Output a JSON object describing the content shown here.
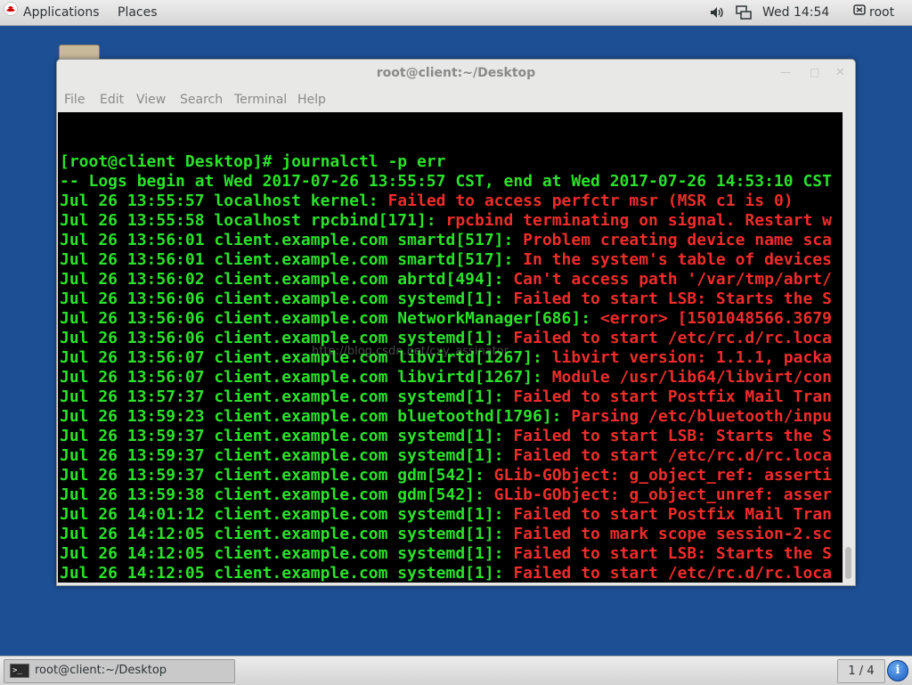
{
  "top_panel": {
    "applications_label": "Applications",
    "places_label": "Places",
    "clock": "Wed 14:54",
    "user_label": "root"
  },
  "window": {
    "title": "root@client:~/Desktop",
    "menu": {
      "file": "File",
      "edit": "Edit",
      "view": "View",
      "search": "Search",
      "terminal": "Terminal",
      "help": "Help"
    }
  },
  "terminal": {
    "lines": [
      {
        "green": "[root@client Desktop]# journalctl -p err",
        "red": ""
      },
      {
        "green": "-- Logs begin at Wed 2017-07-26 13:55:57 CST, end at Wed 2017-07-26 14:53:10 CST",
        "red": ""
      },
      {
        "green": "Jul 26 13:55:57 localhost kernel: ",
        "red": "Failed to access perfctr msr (MSR c1 is 0)"
      },
      {
        "green": "Jul 26 13:55:58 localhost rpcbind[171]: ",
        "red": "rpcbind terminating on signal. Restart w"
      },
      {
        "green": "Jul 26 13:56:01 client.example.com smartd[517]: ",
        "red": "Problem creating device name sca"
      },
      {
        "green": "Jul 26 13:56:01 client.example.com smartd[517]: ",
        "red": "In the system's table of devices"
      },
      {
        "green": "Jul 26 13:56:02 client.example.com abrtd[494]: ",
        "red": "Can't access path '/var/tmp/abrt/"
      },
      {
        "green": "Jul 26 13:56:06 client.example.com systemd[1]: ",
        "red": "Failed to start LSB: Starts the S"
      },
      {
        "green": "Jul 26 13:56:06 client.example.com NetworkManager[686]: ",
        "red": "<error> [1501048566.3679"
      },
      {
        "green": "Jul 26 13:56:06 client.example.com systemd[1]: ",
        "red": "Failed to start /etc/rc.d/rc.loca"
      },
      {
        "green": "Jul 26 13:56:07 client.example.com libvirtd[1267]: ",
        "red": "libvirt version: 1.1.1, packa"
      },
      {
        "green": "Jul 26 13:56:07 client.example.com libvirtd[1267]: ",
        "red": "Module /usr/lib64/libvirt/con"
      },
      {
        "green": "Jul 26 13:57:37 client.example.com systemd[1]: ",
        "red": "Failed to start Postfix Mail Tran"
      },
      {
        "green": "Jul 26 13:59:23 client.example.com bluetoothd[1796]: ",
        "red": "Parsing /etc/bluetooth/inpu"
      },
      {
        "green": "Jul 26 13:59:37 client.example.com systemd[1]: ",
        "red": "Failed to start LSB: Starts the S"
      },
      {
        "green": "Jul 26 13:59:37 client.example.com systemd[1]: ",
        "red": "Failed to start /etc/rc.d/rc.loca"
      },
      {
        "green": "Jul 26 13:59:37 client.example.com gdm[542]: ",
        "red": "GLib-GObject: g_object_ref: asserti"
      },
      {
        "green": "Jul 26 13:59:38 client.example.com gdm[542]: ",
        "red": "GLib-GObject: g_object_unref: asser"
      },
      {
        "green": "Jul 26 14:01:12 client.example.com systemd[1]: ",
        "red": "Failed to start Postfix Mail Tran"
      },
      {
        "green": "Jul 26 14:12:05 client.example.com systemd[1]: ",
        "red": "Failed to mark scope session-2.sc"
      },
      {
        "green": "Jul 26 14:12:05 client.example.com systemd[1]: ",
        "red": "Failed to start LSB: Starts the S"
      },
      {
        "green": "Jul 26 14:12:05 client.example.com systemd[1]: ",
        "red": "Failed to start /etc/rc.d/rc.loca"
      }
    ]
  },
  "watermark": "http://blog.csdn.net/cxy_assinator",
  "bottom_panel": {
    "task_label": "root@client:~/Desktop",
    "workspace": "1 / 4"
  },
  "colors": {
    "desktop_bg": "#1d4f94",
    "terminal_bg": "#000000",
    "terminal_green": "#2ce02c",
    "terminal_red": "#ee2c2c"
  },
  "icons": [
    "redhat-logo-icon",
    "volume-icon",
    "network-icon",
    "user-icon",
    "terminal-icon",
    "info-icon"
  ]
}
